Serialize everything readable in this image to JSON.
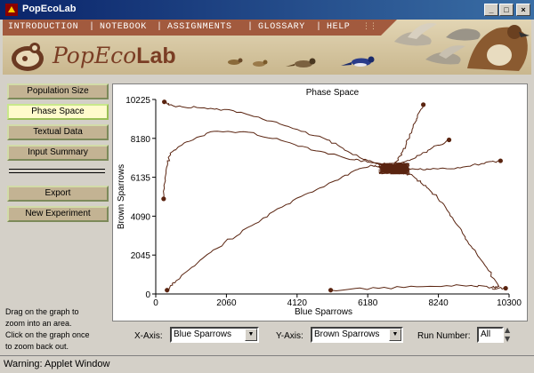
{
  "window": {
    "title": "PopEcoLab"
  },
  "menu": {
    "items": [
      "INTRODUCTION",
      "NOTEBOOK",
      "ASSIGNMENTS",
      "GLOSSARY",
      "HELP"
    ],
    "separator": "|",
    "grip": "⋮⋮"
  },
  "logo": {
    "part1": "PopEco",
    "part2": "Lab"
  },
  "nav": {
    "population_size": "Population Size",
    "phase_space": "Phase Space",
    "textual_data": "Textual Data",
    "input_summary": "Input Summary",
    "export": "Export",
    "new_experiment": "New Experiment",
    "active": "Phase Space"
  },
  "help_text": [
    "Drag on the graph to",
    "zoom into an area.",
    "Click on the graph once",
    "to zoom back out."
  ],
  "controls": {
    "x_axis_label": "X-Axis:",
    "x_axis_value": "Blue Sparrows",
    "y_axis_label": "Y-Axis:",
    "y_axis_value": "Brown Sparrows",
    "run_number_label": "Run Number:",
    "run_number_value": "All"
  },
  "status": {
    "text": "Warning: Applet Window"
  },
  "colors": {
    "trajectory": "#5a2410",
    "menubar": "#a25a3e",
    "title_bar": "#0a246a",
    "active_button": "#fffbcc"
  },
  "chart_data": {
    "type": "line",
    "title": "Phase Space",
    "xlabel": "Blue Sparrows",
    "ylabel": "Brown Sparrows",
    "xlim": [
      0,
      10300
    ],
    "ylim": [
      0,
      10225
    ],
    "xticks": [
      0,
      2060,
      4120,
      6180,
      8240,
      10300
    ],
    "yticks": [
      0,
      2045,
      4090,
      6135,
      8180,
      10225
    ],
    "series": [
      {
        "start": [
          230,
          5000
        ],
        "points": [
          [
            230,
            5000
          ],
          [
            300,
            6500
          ],
          [
            420,
            7400
          ],
          [
            900,
            8000
          ],
          [
            1700,
            8550
          ],
          [
            2700,
            8500
          ],
          [
            3800,
            8000
          ],
          [
            4800,
            7500
          ],
          [
            5800,
            7050
          ],
          [
            6300,
            6900
          ],
          [
            6800,
            6700
          ],
          [
            7100,
            6600
          ]
        ]
      },
      {
        "start": [
          250,
          10100
        ],
        "points": [
          [
            250,
            10100
          ],
          [
            500,
            9900
          ],
          [
            1200,
            9800
          ],
          [
            2000,
            9700
          ],
          [
            3000,
            9300
          ],
          [
            4000,
            8700
          ],
          [
            5000,
            8100
          ],
          [
            5600,
            7500
          ],
          [
            6200,
            7000
          ],
          [
            6600,
            6800
          ],
          [
            6900,
            6650
          ]
        ]
      },
      {
        "start": [
          330,
          200
        ],
        "points": [
          [
            330,
            200
          ],
          [
            600,
            700
          ],
          [
            1200,
            1600
          ],
          [
            2000,
            2700
          ],
          [
            2900,
            3700
          ],
          [
            3800,
            4700
          ],
          [
            4700,
            5500
          ],
          [
            5400,
            6100
          ],
          [
            5900,
            6550
          ],
          [
            6300,
            6750
          ],
          [
            6600,
            6650
          ],
          [
            6800,
            6600
          ]
        ]
      },
      {
        "start": [
          5100,
          200
        ],
        "points": [
          [
            5100,
            200
          ],
          [
            6500,
            300
          ],
          [
            8000,
            400
          ],
          [
            9200,
            450
          ],
          [
            9800,
            350
          ],
          [
            10000,
            400
          ],
          [
            9600,
            1500
          ],
          [
            9200,
            2500
          ],
          [
            8800,
            3600
          ],
          [
            8400,
            4700
          ],
          [
            7900,
            5600
          ],
          [
            7500,
            6200
          ],
          [
            7100,
            6450
          ],
          [
            6900,
            6550
          ]
        ]
      },
      {
        "start": [
          10050,
          7000
        ],
        "points": [
          [
            10050,
            7000
          ],
          [
            9500,
            6850
          ],
          [
            8800,
            6650
          ],
          [
            8000,
            6550
          ],
          [
            7400,
            6550
          ],
          [
            7000,
            6600
          ]
        ]
      },
      {
        "start": [
          8550,
          8100
        ],
        "points": [
          [
            8550,
            8100
          ],
          [
            8000,
            7600
          ],
          [
            7500,
            7100
          ],
          [
            7100,
            6800
          ],
          [
            6900,
            6650
          ]
        ]
      },
      {
        "start": [
          7800,
          9950
        ],
        "points": [
          [
            7800,
            9950
          ],
          [
            7600,
            9200
          ],
          [
            7400,
            8300
          ],
          [
            7200,
            7500
          ],
          [
            7000,
            6900
          ],
          [
            6900,
            6650
          ]
        ]
      },
      {
        "start": [
          10200,
          300
        ],
        "points": [
          [
            10200,
            300
          ],
          [
            9800,
            300
          ]
        ]
      }
    ],
    "cluster_center": [
      6950,
      6600
    ]
  }
}
